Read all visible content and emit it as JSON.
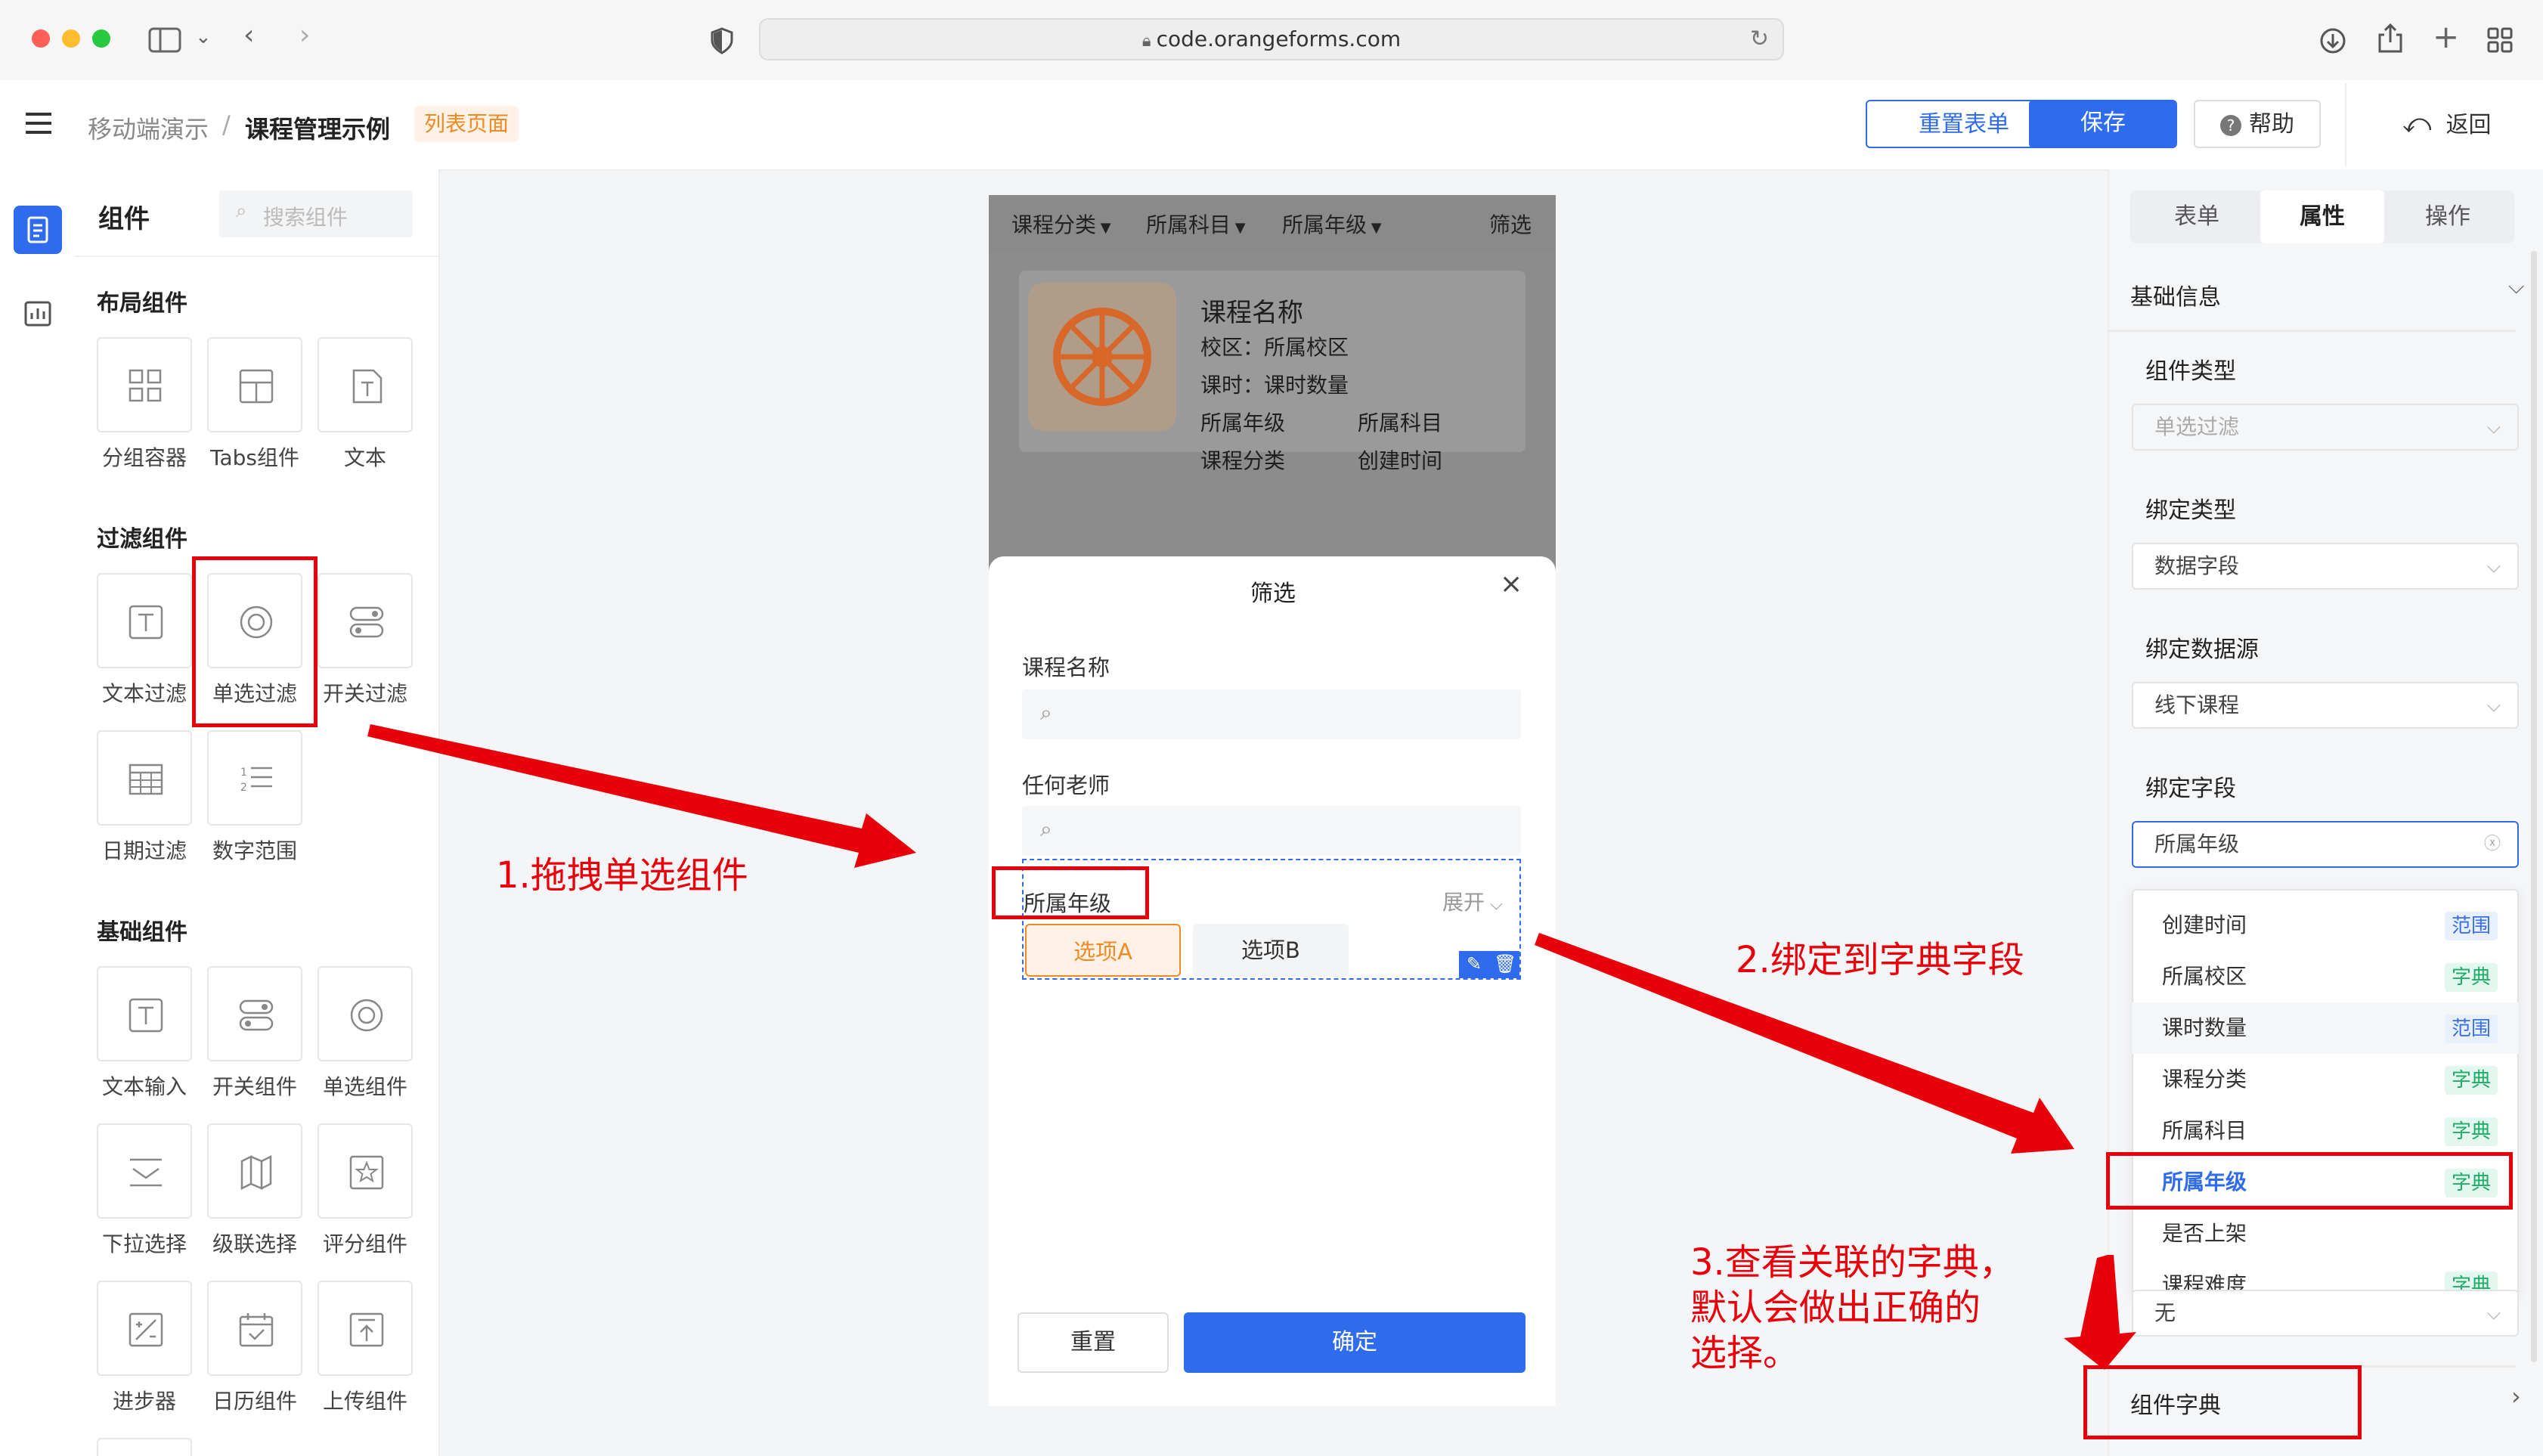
{
  "browser": {
    "url": "code.orangeforms.com"
  },
  "header": {
    "breadcrumb": [
      "移动端演示",
      "/",
      "课程管理示例"
    ],
    "page_tag": "列表页面",
    "reset_button": "重置表单",
    "save_button": "保存",
    "help_button": "帮助",
    "back_button": "返回"
  },
  "component_panel": {
    "title": "组件",
    "search_placeholder": "搜索组件",
    "sections": [
      {
        "title": "布局组件",
        "items": [
          {
            "label": "分组容器",
            "icon": "grid-icon"
          },
          {
            "label": "Tabs组件",
            "icon": "tabs-icon"
          },
          {
            "label": "文本",
            "icon": "text-doc-icon"
          }
        ]
      },
      {
        "title": "过滤组件",
        "items": [
          {
            "label": "文本过滤",
            "icon": "text-t-icon"
          },
          {
            "label": "单选过滤",
            "icon": "radio-icon"
          },
          {
            "label": "开关过滤",
            "icon": "switch-icon"
          },
          {
            "label": "日期过滤",
            "icon": "table-grid-icon"
          },
          {
            "label": "数字范围",
            "icon": "number-list-icon"
          }
        ]
      },
      {
        "title": "基础组件",
        "items": [
          {
            "label": "文本输入",
            "icon": "text-t-icon"
          },
          {
            "label": "开关组件",
            "icon": "switch-icon"
          },
          {
            "label": "单选组件",
            "icon": "radio-icon"
          },
          {
            "label": "下拉选择",
            "icon": "dropdown-icon"
          },
          {
            "label": "级联选择",
            "icon": "cascade-icon"
          },
          {
            "label": "评分组件",
            "icon": "star-icon"
          },
          {
            "label": "进步器",
            "icon": "stepper-icon"
          },
          {
            "label": "日历组件",
            "icon": "calendar-icon"
          },
          {
            "label": "上传组件",
            "icon": "upload-icon"
          }
        ]
      }
    ]
  },
  "canvas": {
    "filter_bar": [
      "课程分类",
      "所属科目",
      "所属年级"
    ],
    "filter_button": "筛选",
    "card": {
      "title": "课程名称",
      "line1": "校区：所属校区",
      "line2": "课时：课时数量",
      "col_a": [
        "所属年级",
        "课程分类"
      ],
      "col_b": [
        "所属科目",
        "创建时间"
      ]
    },
    "sheet": {
      "title": "筛选",
      "field1": "课程名称",
      "field2": "任何老师",
      "field3": "所属年级",
      "expand": "展开",
      "option_a": "选项A",
      "option_b": "选项B",
      "reset": "重置",
      "confirm": "确定"
    }
  },
  "properties": {
    "tabs": [
      "表单",
      "属性",
      "操作"
    ],
    "active_tab": "属性",
    "section": "基础信息",
    "component_type_label": "组件类型",
    "component_type_value": "单选过滤",
    "bind_type_label": "绑定类型",
    "bind_type_value": "数据字段",
    "bind_source_label": "绑定数据源",
    "bind_source_value": "线下课程",
    "bind_field_label": "绑定字段",
    "bind_field_value": "所属年级",
    "dropdown": [
      {
        "text": "创建时间",
        "tag": "范围",
        "kind": "range"
      },
      {
        "text": "所属校区",
        "tag": "字典",
        "kind": "dict"
      },
      {
        "text": "课时数量",
        "tag": "范围",
        "kind": "range"
      },
      {
        "text": "课程分类",
        "tag": "字典",
        "kind": "dict"
      },
      {
        "text": "所属科目",
        "tag": "字典",
        "kind": "dict"
      },
      {
        "text": "所属年级",
        "tag": "字典",
        "kind": "dict"
      },
      {
        "text": "是否上架",
        "tag": "",
        "kind": ""
      },
      {
        "text": "课程难度",
        "tag": "字典",
        "kind": "dict"
      }
    ],
    "below_value": "无",
    "dict_label": "组件字典"
  },
  "annotations": {
    "step1": "1.拖拽单选组件",
    "step2": "2.绑定到字典字段",
    "step3": [
      "3.查看关联的字典，",
      "默认会做出正确的",
      "选择。"
    ]
  },
  "colors": {
    "primary": "#2f6bed",
    "annotation_red": "#e8000b",
    "orange": "#f08a24"
  }
}
